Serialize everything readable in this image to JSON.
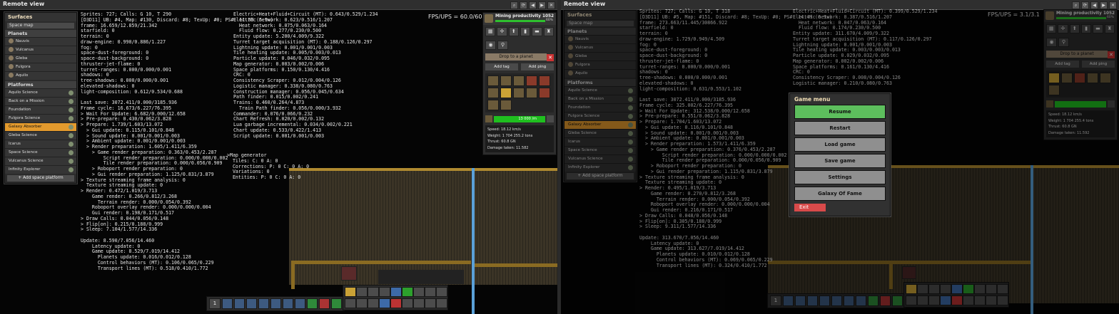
{
  "left_pane": {
    "title": "Remote view",
    "window_controls": [
      "⌕",
      "⟳",
      "◀",
      "▶",
      "✕"
    ],
    "surfaces": {
      "header": "Surfaces",
      "space_map": "Space map",
      "planets_header": "Planets",
      "planets": [
        "Nauvis",
        "Vulcanus",
        "Gleba",
        "Fulgora",
        "Aquilo"
      ],
      "platforms_header": "Platforms",
      "platforms": [
        "Aquilo Science",
        "Back on a Mission",
        "Foundation",
        "Fulgora Science",
        "Galaxy Absorber",
        "Gleba Science",
        "Icarus",
        "Space Science",
        "Vulcanus Science",
        "Infinity Explorer"
      ],
      "selected_platform": "Galaxy Absorber",
      "add_platform": "+ Add space platform"
    },
    "debug_col1": "Sprites: 727; Calls: G 10, T 290\n[D3D11] UB: #4, Map: #130, Discard: #8; TexUp: #0; PS#: 11.5M (5.9x)\nframe: 16.659/12.859/21.342\nstarfield: 0\nterrain: 0\ndraw-engine: 0.990/0.886/1.227\nfog: 0\nspace-dust-foreground: 0\nspace-dust-background: 0\nthruster-jet-flame: 0\nturret-ranges: 0.000/0.000/0.001\nshadows: 0\ntree-shadows: 0.000/0.000/0.001\nelevated-shadows: 0\nlight-composition: 0.612/0.534/0.688\n\nLast save: 3072.411/0.000/3185.936\nFrame cycle: 16.673/6.227/76.395\n> Wait For Update: 6.682/0.000/12.658\n> Pre-prepare: 0.430/0.062/3.828\n> Prepare: 1.739/1.603/13.072\n  > Gui update: 0.115/0.101/0.848\n  > Sound update: 0.001/0.001/0.003\n  > Ambient update: 0.001/0.001/0.003\n  > Render preparation: 1.605/1.411/6.359\n    > Game render preparation: 0.363/0.453/2.287\n        Script render preparation: 0.000/0.000/0.002\n        Tile render preparation: 0.000/0.056/0.909\n    > Roboport render preparation: 0\n    > Gui render preparation: 1.125/0.831/3.879\n> Texture streaming frame analysis: 0\n  Texture streaming update: 0\n> Render: 0.472/1.019/3.713\n    Game render: 0.266/0.812/3.268\n      Terrain render: 0.000/0.054/0.392\n    Roboport overlay render: 0.000/0.000/0.004\n    Gui render: 0.198/0.171/0.517\n> Draw Calls: 0.044/0.056/0.148\n> Flip[on]: 0.215/0.188/0.999\n> Sleep: 7.104/1.577/14.336\n\nUpdate: 8.590/7.056/14.460\n    Latency update: 0\n    Game update: 8.529/7.019/14.412\n      Planets update: 0.016/0.012/0.128\n      Control behaviors (MT): 0.106/0.065/0.229\n      Transport lines (MT): 0.518/0.410/1.772",
    "debug_col2": "Electric+Heat+Fluid+Circuit (MT): 0.643/0.529/1.234\nElectric network: 0.623/0.516/1.207\n  Heat network: 0.075/0.063/0.164\n  Fluid flow: 0.277/0.230/0.500\nEntity update: 5.200/4.009/9.322\nTurret target acquisition (MT): 0.188/0.126/0.297\nLightning update: 0.001/0.001/0.003\nTile heating update: 0.005/0.003/0.013\nParticle update: 0.046/0.032/0.095\nMap generator: 0.003/0.002/0.006\nSpace platforms: 0.150/0.130/4.416\nCRC: 0\nConsistency Scraper: 0.012/0.004/0.126\nLogistic manager: 0.338/0.080/0.763\nConstruction manager: 0.056/0.045/0.634\nPath finder: 0.015/0.002/0.241\nTrains: 0.460/0.264/4.873\n  Train Path finder: 0.056/0.000/3.932\nCommander: 0.076/0.066/0.232\nChart Refresh: 0.020/0.002/0.132\nLua garbage incremental: 0.034/0.002/0.221\nChart update: 0.533/0.422/1.413\nScript update: 0.001/0.001/0.003",
    "map_gen": ">Map generator\n  Tiles: C: 0 A: 0\n  Corrections: P: 0 C: 0 A: 0\n  Variations: 0\n  Entities: P: 0 C: 0 A: 0",
    "fps": "FPS/UPS = 60.0/60.0",
    "info_panel": {
      "name": "Mining productivity 1052",
      "progress_text": "60%",
      "progress_fraction": 0.6,
      "drop_label": "Drop to a planet",
      "add_tag": "Add tag",
      "add_ping": "Add ping",
      "fuel_text": "13 000 /m",
      "speed": "Speed: 18.12 km/s",
      "weight": "Weight: 1 704 255.2 tons",
      "thrust": "Thrust: 60.8 GN",
      "damage": "Damage taken: 11.582"
    },
    "quickbar_number": "1"
  },
  "right_pane": {
    "title": "Remote view",
    "debug_col1": "Sprites: 727; Calls: G 10, T 318\n[D3D11] UB: #5, Map: #151, Discard: #8; TexUp: #0; PS#: 14.4M (6.9x)\nframe: 273.663/11.445/30866.922\nstarfield: 0\nterrain: 0\ndraw-engine: 1.729/0.949/4.509\nfog: 0\nspace-dust-foreground: 0\nspace-dust-background: 0\nthruster-jet-flame: 0\nturret-ranges: 0.000/0.000/0.001\nshadows: 0\ntree-shadows: 0.000/0.000/0.001\nelevated-shadows: 0\nlight-composition: 0.631/0.553/1.102\n\nLast save: 3072.411/0.000/3185.936\nFrame cycle: 325.002/6.227/76.395\n> Wait For Update: 312.538/0.000/12.658\n> Pre-prepare: 0.551/0.062/3.828\n> Prepare: 1.704/1.603/13.072\n  > Gui update: 0.116/0.101/0.848\n  > Sound update: 0.001/0.001/0.003\n  > Ambient update: 0.001/0.001/0.003\n  > Render preparation: 1.573/1.411/6.359\n    > Game render preparation: 0.376/0.453/2.287\n        Script render preparation: 0.000/0.000/0.002\n        Tile render preparation: 0.000/0.056/0.909\n    > Roboport render preparation: 0\n    > Gui render preparation: 1.115/0.831/3.879\n> Texture streaming frame analysis: 0\n  Texture streaming update: 0\n> Render: 0.495/1.019/3.713\n    Game render: 0.270/0.812/3.268\n      Terrain render: 0.000/0.054/0.392\n    Roboport overlay render: 0.000/0.000/0.004\n    Gui render: 0.216/0.171/0.517\n> Draw Calls: 0.048/0.056/0.148\n> Flip[on]: 0.305/0.188/0.999\n> Sleep: 9.311/1.577/14.336\n\nUpdate: 313.670/7.056/14.460\n    Latency update: 0\n    Game update: 313.627/7.019/14.412\n      Planets update: 0.010/0.012/0.128\n      Control behaviors (MT): 0.069/0.065/0.229\n      Transport lines (MT): 0.324/0.410/1.772",
    "debug_col2": "Electric+Heat+Fluid+Circuit (MT): 0.399/0.529/1.234\nElectric network: 0.387/0.516/1.207\n  Heat network: 0.047/0.063/0.164\n  Fluid flow: 0.174/0.230/0.500\nEntity update: 311.670/4.009/9.322\nTurret target acquisition (MT): 0.117/0.126/0.297\nLightning update: 0.001/0.001/0.003\nTile heating update: 0.003/0.003/0.013\nParticle update: 0.029/0.032/0.095\nMap generator: 0.002/0.002/0.006\nSpace platforms: 0.161/0.130/4.416\nCRC: 0\nConsistency Scraper: 0.008/0.004/0.126\nLogistic manager: 0.210/0.080/0.763",
    "fps": "FPS/UPS = 3.1/3.1",
    "info_panel": {
      "name": "Mining productivity 1052",
      "progress_text": "60%",
      "drop_label": "Drop to a planet",
      "add_tag": "Add tag",
      "add_ping": "Add ping",
      "speed": "Speed: 18.12 km/s",
      "weight": "Weight: 1 704 255.4 tons",
      "thrust": "Thrust: 60.8 GN",
      "damage": "Damage taken: 11.592"
    },
    "game_menu": {
      "title": "Game menu",
      "items": [
        "Resume",
        "Restart",
        "Load game",
        "Save game",
        "Settings",
        "Galaxy Of Fame"
      ],
      "exit": "Exit"
    },
    "quickbar_number": "1"
  }
}
